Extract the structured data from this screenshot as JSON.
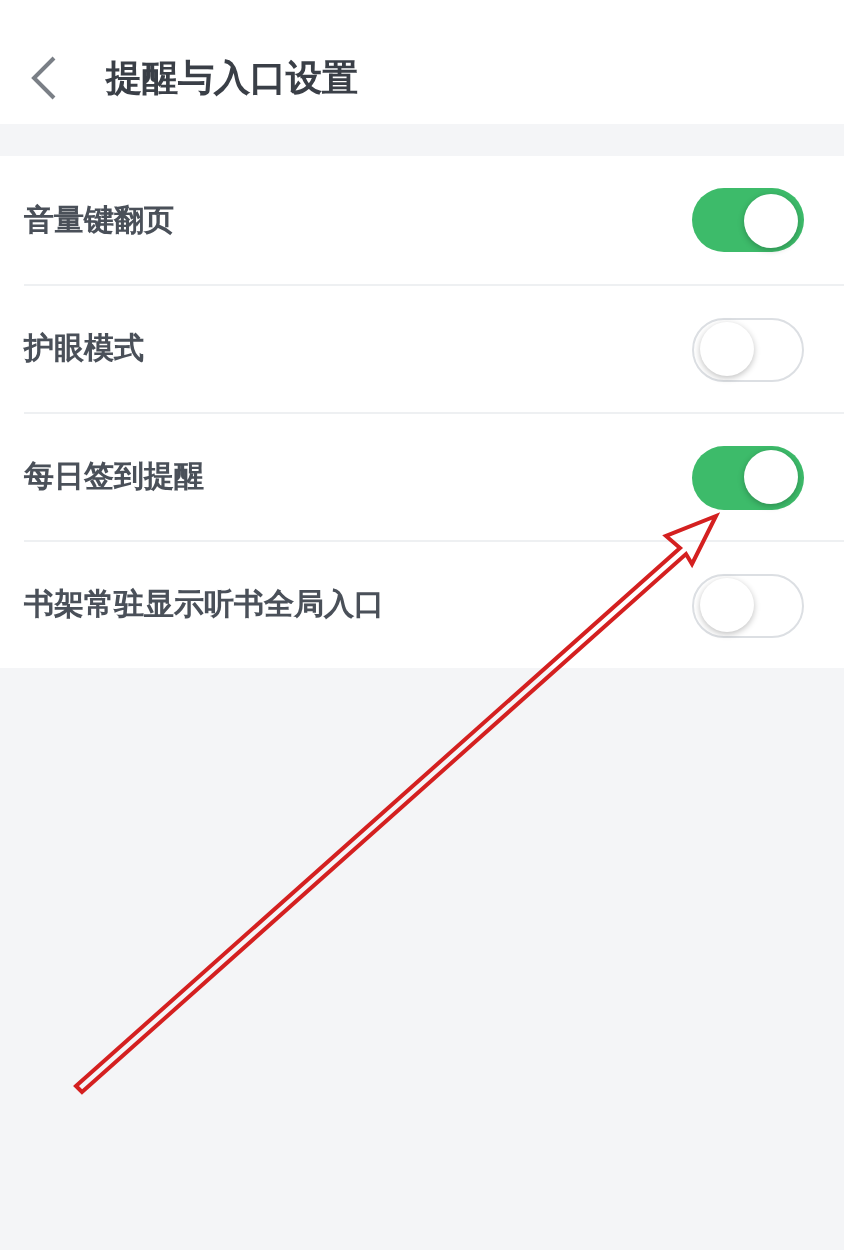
{
  "header": {
    "title": "提醒与入口设置"
  },
  "settings": [
    {
      "label": "音量键翻页",
      "on": true
    },
    {
      "label": "护眼模式",
      "on": false
    },
    {
      "label": "每日签到提醒",
      "on": true
    },
    {
      "label": "书架常驻显示听书全局入口",
      "on": false
    }
  ]
}
